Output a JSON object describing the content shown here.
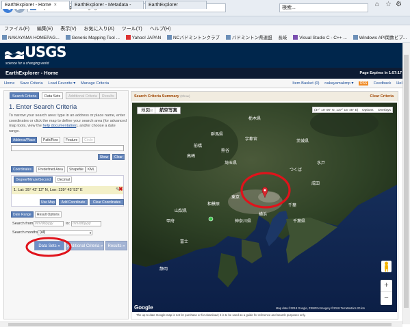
{
  "browser": {
    "url": "https://earthexplorer.usgs.gov/",
    "search_placeholder": "検索...",
    "tabs": [
      {
        "label": "EarthExplorer - Home"
      },
      {
        "label": "EarthExplorer - Metadata -"
      },
      {
        "label": "EarthExplorer"
      }
    ],
    "menu": [
      "ファイル(F)",
      "編集(E)",
      "表示(V)",
      "お気に入り(A)",
      "ツール(T)",
      "ヘルプ(H)"
    ],
    "favorites": [
      "NAKAYAMA HOMEPAG...",
      "Generic Mapping Tool ...",
      "Yahoo! JAPAN",
      "NCバドミントンクラブ",
      "バドミントン県連盟",
      "長岐",
      "Visual Studio C - C++ ...",
      "Windows API関数ビブ..."
    ]
  },
  "site": {
    "logo_name": "USGS",
    "tagline": "science for a changing world",
    "page_title": "EarthExplorer - Home",
    "expires": "Page Expires In 1:57:17",
    "nav_left": [
      "Home",
      "Save Criteria",
      "Load Favorite ▾",
      "Manage Criteria"
    ],
    "nav_right": [
      "Item Basket (0)",
      "nakayamakmp ▾",
      "Feedback",
      "Help"
    ],
    "nav_right_badge": "RSS"
  },
  "left": {
    "step_tabs": [
      "Search Criteria",
      "Data Sets",
      "Additional Criteria",
      "Results"
    ],
    "heading": "1. Enter Search Criteria",
    "instructions_pre": "To narrow your search area: type in an address or place name, enter coordinates or click the map to define your search area (for advanced map tools, view the ",
    "instructions_link": "help documentation",
    "instructions_post": "), and/or choose a date range.",
    "address_tabs": [
      "Address/Place",
      "Path/Row",
      "Feature",
      "Circle"
    ],
    "show_btn": "Show",
    "clear_btn": "Clear",
    "coord_tabs": [
      "Coordinates",
      "Predefined Area",
      "Shapefile",
      "KML"
    ],
    "format_tabs": [
      "Degree/Minute/Second",
      "Decimal"
    ],
    "coord_entry": "1.  Lat: 35° 42' 12\" N, Lon: 139° 43' 52\" E",
    "use_map_btn": "Use Map",
    "add_coord_btn": "Add Coordinate",
    "clear_coords_btn": "Clear Coordinates",
    "date_tabs": [
      "Date Range",
      "Result Options"
    ],
    "search_from_label": "Search from:",
    "date_placeholder": "mm/dd/yyyy",
    "to_label": "to:",
    "search_months_label": "Search months:",
    "search_months_value": "(all)",
    "data_sets_btn": "Data Sets »",
    "additional_btn": "Additional Criteria »",
    "results_btn": "Results »"
  },
  "map": {
    "summary_title": "Search Criteria Summary",
    "summary_show": "(Show)",
    "clear_criteria": "Clear Criteria",
    "map_btn": "地図",
    "aerial_btn": "航空写真",
    "coord_readout": "(37° 10' 06\" N, 137° 15' 45\" E)",
    "options": "Options",
    "overlays": "Overlays",
    "google": "Google",
    "attribution": "Map data ©2018 Google, ZENRIN  Imagery ©2018 TerraMetrics   20 km",
    "footer_note": "The up to date Google map is not for purchase or for download; it is to be used as a guide for reference and search purposes only.",
    "place_labels": [
      "栃木県",
      "群馬県",
      "茨城県",
      "埼玉県",
      "東京",
      "山梨県",
      "神奈川県",
      "千葉県",
      "相模原",
      "水戸",
      "宇都宮",
      "前橋",
      "高崎",
      "熊谷",
      "つくば",
      "成田",
      "横浜",
      "千葉",
      "甲府",
      "静岡",
      "富士"
    ],
    "zoom_in": "+",
    "zoom_out": "−"
  },
  "colors": {
    "usgs_navy": "#00264c",
    "annotation_red": "#e0131b",
    "tab_blue": "#5a7fb8"
  }
}
